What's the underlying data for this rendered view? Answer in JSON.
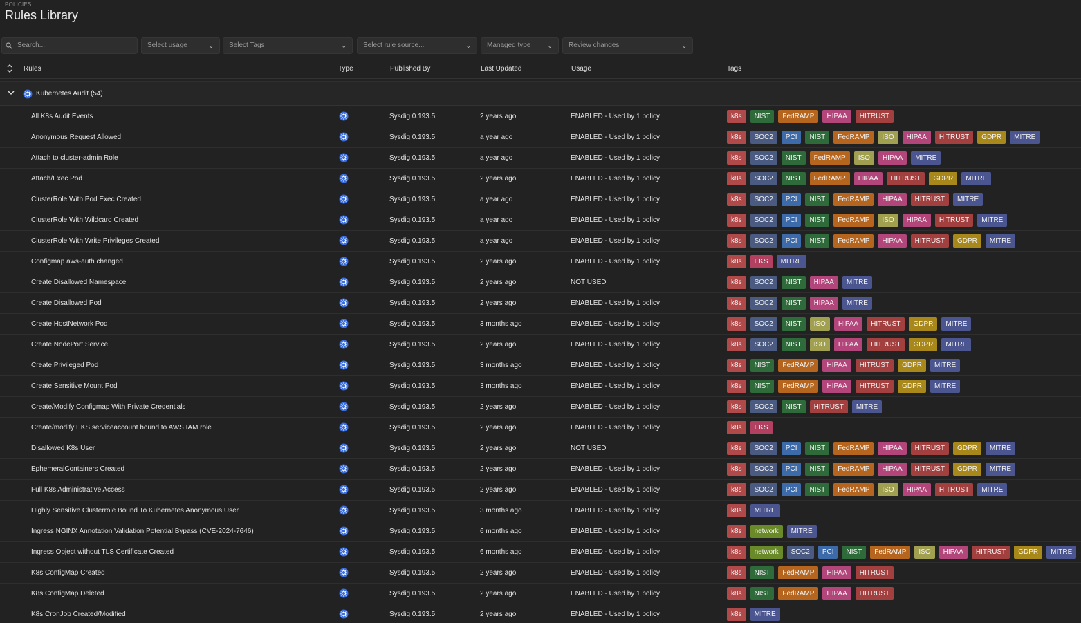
{
  "header": {
    "breadcrumb": "POLICIES",
    "title": "Rules Library"
  },
  "filters": {
    "search_placeholder": "Search...",
    "usage": "Select usage",
    "tags": "Select Tags",
    "source": "Select rule source...",
    "managed": "Managed type",
    "review": "Review changes"
  },
  "columns": {
    "rules": "Rules",
    "type": "Type",
    "published": "Published By",
    "updated": "Last Updated",
    "usage": "Usage",
    "tags": "Tags"
  },
  "group": {
    "label": "Kubernetes Audit (54)"
  },
  "colors": {
    "background": "#222222",
    "k8s_icon": "#3b6fe0"
  },
  "rows": [
    {
      "rule": "All K8s Audit Events",
      "published": "Sysdig 0.193.5",
      "updated": "2 years ago",
      "usage": "ENABLED - Used by 1 policy",
      "tags": [
        "k8s",
        "NIST",
        "FedRAMP",
        "HIPAA",
        "HITRUST"
      ]
    },
    {
      "rule": "Anonymous Request Allowed",
      "published": "Sysdig 0.193.5",
      "updated": "a year ago",
      "usage": "ENABLED - Used by 1 policy",
      "tags": [
        "k8s",
        "SOC2",
        "PCI",
        "NIST",
        "FedRAMP",
        "ISO",
        "HIPAA",
        "HITRUST",
        "GDPR",
        "MITRE"
      ]
    },
    {
      "rule": "Attach to cluster-admin Role",
      "published": "Sysdig 0.193.5",
      "updated": "a year ago",
      "usage": "ENABLED - Used by 1 policy",
      "tags": [
        "k8s",
        "SOC2",
        "NIST",
        "FedRAMP",
        "ISO",
        "HIPAA",
        "MITRE"
      ]
    },
    {
      "rule": "Attach/Exec Pod",
      "published": "Sysdig 0.193.5",
      "updated": "2 years ago",
      "usage": "ENABLED - Used by 1 policy",
      "tags": [
        "k8s",
        "SOC2",
        "NIST",
        "FedRAMP",
        "HIPAA",
        "HITRUST",
        "GDPR",
        "MITRE"
      ]
    },
    {
      "rule": "ClusterRole With Pod Exec Created",
      "published": "Sysdig 0.193.5",
      "updated": "a year ago",
      "usage": "ENABLED - Used by 1 policy",
      "tags": [
        "k8s",
        "SOC2",
        "PCI",
        "NIST",
        "FedRAMP",
        "HIPAA",
        "HITRUST",
        "MITRE"
      ]
    },
    {
      "rule": "ClusterRole With Wildcard Created",
      "published": "Sysdig 0.193.5",
      "updated": "a year ago",
      "usage": "ENABLED - Used by 1 policy",
      "tags": [
        "k8s",
        "SOC2",
        "PCI",
        "NIST",
        "FedRAMP",
        "ISO",
        "HIPAA",
        "HITRUST",
        "MITRE"
      ]
    },
    {
      "rule": "ClusterRole With Write Privileges Created",
      "published": "Sysdig 0.193.5",
      "updated": "a year ago",
      "usage": "ENABLED - Used by 1 policy",
      "tags": [
        "k8s",
        "SOC2",
        "PCI",
        "NIST",
        "FedRAMP",
        "HIPAA",
        "HITRUST",
        "GDPR",
        "MITRE"
      ]
    },
    {
      "rule": "Configmap aws-auth changed",
      "published": "Sysdig 0.193.5",
      "updated": "2 years ago",
      "usage": "ENABLED - Used by 1 policy",
      "tags": [
        "k8s",
        "EKS",
        "MITRE"
      ]
    },
    {
      "rule": "Create Disallowed Namespace",
      "published": "Sysdig 0.193.5",
      "updated": "2 years ago",
      "usage": "NOT USED",
      "tags": [
        "k8s",
        "SOC2",
        "NIST",
        "HIPAA",
        "MITRE"
      ]
    },
    {
      "rule": "Create Disallowed Pod",
      "published": "Sysdig 0.193.5",
      "updated": "2 years ago",
      "usage": "ENABLED - Used by 1 policy",
      "tags": [
        "k8s",
        "SOC2",
        "NIST",
        "HIPAA",
        "MITRE"
      ]
    },
    {
      "rule": "Create HostNetwork Pod",
      "published": "Sysdig 0.193.5",
      "updated": "3 months ago",
      "usage": "ENABLED - Used by 1 policy",
      "tags": [
        "k8s",
        "SOC2",
        "NIST",
        "ISO",
        "HIPAA",
        "HITRUST",
        "GDPR",
        "MITRE"
      ]
    },
    {
      "rule": "Create NodePort Service",
      "published": "Sysdig 0.193.5",
      "updated": "2 years ago",
      "usage": "ENABLED - Used by 1 policy",
      "tags": [
        "k8s",
        "SOC2",
        "NIST",
        "ISO",
        "HIPAA",
        "HITRUST",
        "GDPR",
        "MITRE"
      ]
    },
    {
      "rule": "Create Privileged Pod",
      "published": "Sysdig 0.193.5",
      "updated": "3 months ago",
      "usage": "ENABLED - Used by 1 policy",
      "tags": [
        "k8s",
        "NIST",
        "FedRAMP",
        "HIPAA",
        "HITRUST",
        "GDPR",
        "MITRE"
      ]
    },
    {
      "rule": "Create Sensitive Mount Pod",
      "published": "Sysdig 0.193.5",
      "updated": "3 months ago",
      "usage": "ENABLED - Used by 1 policy",
      "tags": [
        "k8s",
        "NIST",
        "FedRAMP",
        "HIPAA",
        "HITRUST",
        "GDPR",
        "MITRE"
      ]
    },
    {
      "rule": "Create/Modify Configmap With Private Credentials",
      "published": "Sysdig 0.193.5",
      "updated": "2 years ago",
      "usage": "ENABLED - Used by 1 policy",
      "tags": [
        "k8s",
        "SOC2",
        "NIST",
        "HITRUST",
        "MITRE"
      ]
    },
    {
      "rule": "Create/modify EKS serviceaccount bound to AWS IAM role",
      "published": "Sysdig 0.193.5",
      "updated": "2 years ago",
      "usage": "ENABLED - Used by 1 policy",
      "tags": [
        "k8s",
        "EKS"
      ]
    },
    {
      "rule": "Disallowed K8s User",
      "published": "Sysdig 0.193.5",
      "updated": "2 years ago",
      "usage": "NOT USED",
      "tags": [
        "k8s",
        "SOC2",
        "PCI",
        "NIST",
        "FedRAMP",
        "HIPAA",
        "HITRUST",
        "GDPR",
        "MITRE"
      ]
    },
    {
      "rule": "EphemeralContainers Created",
      "published": "Sysdig 0.193.5",
      "updated": "2 years ago",
      "usage": "ENABLED - Used by 1 policy",
      "tags": [
        "k8s",
        "SOC2",
        "PCI",
        "NIST",
        "FedRAMP",
        "HIPAA",
        "HITRUST",
        "GDPR",
        "MITRE"
      ]
    },
    {
      "rule": "Full K8s Administrative Access",
      "published": "Sysdig 0.193.5",
      "updated": "2 years ago",
      "usage": "ENABLED - Used by 1 policy",
      "tags": [
        "k8s",
        "SOC2",
        "PCI",
        "NIST",
        "FedRAMP",
        "ISO",
        "HIPAA",
        "HITRUST",
        "MITRE"
      ]
    },
    {
      "rule": "Highly Sensitive Clusterrole Bound To Kubernetes Anonymous User",
      "published": "Sysdig 0.193.5",
      "updated": "3 months ago",
      "usage": "ENABLED - Used by 1 policy",
      "tags": [
        "k8s",
        "MITRE"
      ]
    },
    {
      "rule": "Ingress NGINX Annotation Validation Potential Bypass (CVE-2024-7646)",
      "published": "Sysdig 0.193.5",
      "updated": "6 months ago",
      "usage": "ENABLED - Used by 1 policy",
      "tags": [
        "k8s",
        "network",
        "MITRE"
      ]
    },
    {
      "rule": "Ingress Object without TLS Certificate Created",
      "published": "Sysdig 0.193.5",
      "updated": "6 months ago",
      "usage": "ENABLED - Used by 1 policy",
      "tags": [
        "k8s",
        "network",
        "SOC2",
        "PCI",
        "NIST",
        "FedRAMP",
        "ISO",
        "HIPAA",
        "HITRUST",
        "GDPR",
        "MITRE"
      ]
    },
    {
      "rule": "K8s ConfigMap Created",
      "published": "Sysdig 0.193.5",
      "updated": "2 years ago",
      "usage": "ENABLED - Used by 1 policy",
      "tags": [
        "k8s",
        "NIST",
        "FedRAMP",
        "HIPAA",
        "HITRUST"
      ]
    },
    {
      "rule": "K8s ConfigMap Deleted",
      "published": "Sysdig 0.193.5",
      "updated": "2 years ago",
      "usage": "ENABLED - Used by 1 policy",
      "tags": [
        "k8s",
        "NIST",
        "FedRAMP",
        "HIPAA",
        "HITRUST"
      ]
    },
    {
      "rule": "K8s CronJob Created/Modified",
      "published": "Sysdig 0.193.5",
      "updated": "2 years ago",
      "usage": "ENABLED - Used by 1 policy",
      "tags": [
        "k8s",
        "MITRE"
      ]
    }
  ]
}
